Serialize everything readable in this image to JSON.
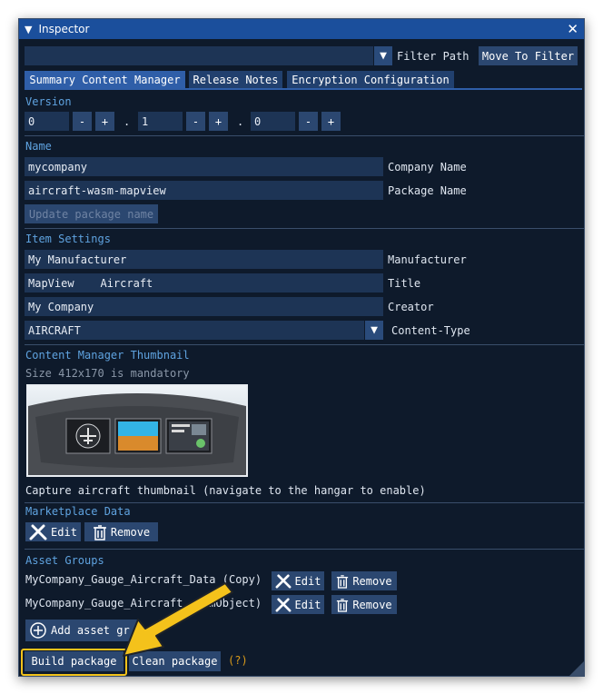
{
  "window": {
    "title": "Inspector"
  },
  "top": {
    "filter_path_label": "Filter Path",
    "move_to_filter_label": "Move To Filter"
  },
  "tabs": [
    {
      "label": "Summary Content Manager"
    },
    {
      "label": "Release Notes"
    },
    {
      "label": "Encryption Configuration"
    }
  ],
  "version": {
    "title": "Version",
    "major": "0",
    "minor": "1",
    "patch": "0",
    "minus": "-",
    "plus": "+",
    "dot": "."
  },
  "name": {
    "title": "Name",
    "company_value": "mycompany",
    "company_label": "Company Name",
    "package_value": "aircraft-wasm-mapview",
    "package_label": "Package Name",
    "update_button": "Update package name"
  },
  "item_settings": {
    "title": "Item Settings",
    "manufacturer_value": "My Manufacturer",
    "manufacturer_label": "Manufacturer",
    "title_value": "MapView    Aircraft",
    "title_label": "Title",
    "creator_value": "My Company",
    "creator_label": "Creator",
    "content_type_value": "AIRCRAFT",
    "content_type_label": "Content-Type"
  },
  "thumbnail": {
    "title": "Content Manager Thumbnail",
    "size_hint": "Size 412x170 is mandatory",
    "capture_text": "Capture aircraft thumbnail (navigate to the hangar to enable)"
  },
  "marketplace": {
    "title": "Marketplace Data",
    "edit_label": "Edit",
    "remove_label": "Remove"
  },
  "asset_groups": {
    "title": "Asset Groups",
    "items": [
      {
        "name": "MyCompany_Gauge_Aircraft_Data (Copy)",
        "edit_label": "Edit",
        "remove_label": "Remove"
      },
      {
        "name": "MyCompany_Gauge_Aircraft    mObject)",
        "edit_label": "Edit",
        "remove_label": "Remove"
      }
    ],
    "add_label": "Add asset gr"
  },
  "footer": {
    "build_label": "Build package",
    "clean_label": "Clean package",
    "help_label": "(?)"
  },
  "colors": {
    "accent": "#2f5ea8",
    "highlight": "#f2c21a",
    "section": "#5fa3e0"
  }
}
